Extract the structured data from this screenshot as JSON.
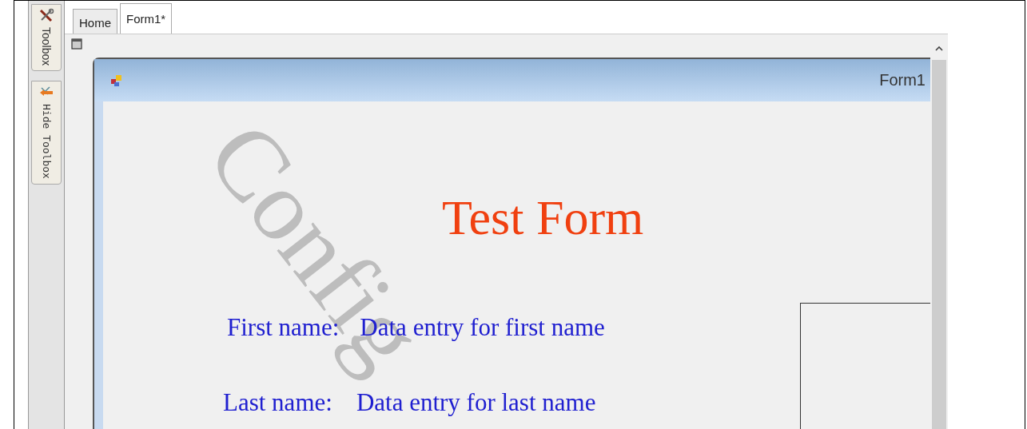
{
  "toolbox_tabs": [
    {
      "label": "Toolbox",
      "kind": "tools"
    },
    {
      "label": "Hide Toolbox",
      "kind": "hide"
    }
  ],
  "tabs": [
    {
      "label": "Home",
      "selected": false
    },
    {
      "label": "Form1*",
      "selected": true
    }
  ],
  "form": {
    "title": "Form1",
    "heading": "Test Form",
    "watermark": "Config",
    "fields": [
      {
        "label": "First name:",
        "text": "Data entry for first name"
      },
      {
        "label": "Last name:",
        "text": "Data entry for last name"
      }
    ]
  }
}
